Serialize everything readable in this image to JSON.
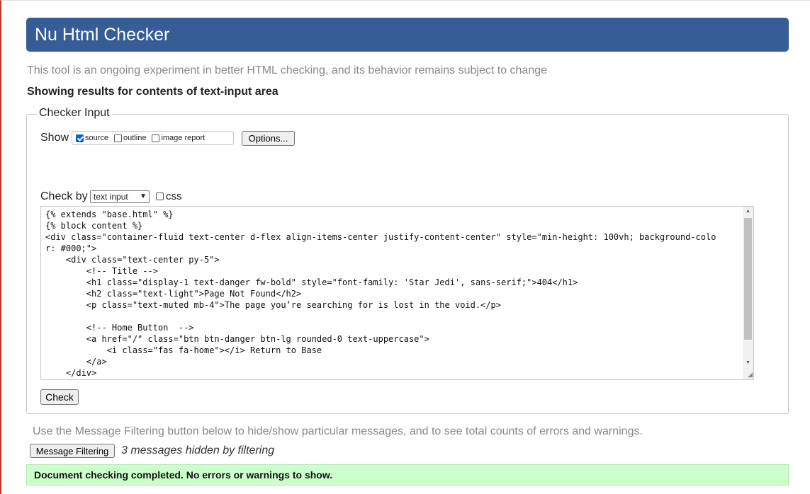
{
  "header": {
    "title": "Nu Html Checker"
  },
  "intro": "This tool is an ongoing experiment in better HTML checking, and its behavior remains subject to change",
  "results_heading": "Showing results for contents of text-input area",
  "checker_input": {
    "legend": "Checker Input",
    "show_label": "Show",
    "show_options": [
      {
        "label": "source",
        "checked": true
      },
      {
        "label": "outline",
        "checked": false
      },
      {
        "label": "image report",
        "checked": false
      }
    ],
    "options_button": "Options...",
    "check_by_label": "Check by",
    "check_by_selected": "text input",
    "css_label": "css",
    "source_code": "{% extends \"base.html\" %}\n{% block content %}\n<div class=\"container-fluid text-center d-flex align-items-center justify-content-center\" style=\"min-height: 100vh; background-color: #000;\">\n    <div class=\"text-center py-5\">\n        <!-- Title -->\n        <h1 class=\"display-1 text-danger fw-bold\" style=\"font-family: 'Star Jedi', sans-serif;\">404</h1>\n        <h2 class=\"text-light\">Page Not Found</h2>\n        <p class=\"text-muted mb-4\">The page you’re searching for is lost in the void.</p>\n\n        <!-- Home Button  -->\n        <a href=\"/\" class=\"btn btn-danger btn-lg rounded-0 text-uppercase\">\n            <i class=\"fas fa-home\"></i> Return to Base\n        </a>\n    </div>",
    "check_button": "Check"
  },
  "filtering": {
    "note": "Use the Message Filtering button below to hide/show particular messages, and to see total counts of errors and warnings.",
    "button": "Message Filtering",
    "hidden_count": "3 messages hidden by filtering"
  },
  "result": "Document checking completed. No errors or warnings to show.",
  "colors": {
    "header_bg": "#365d95",
    "success_bg": "#ccffcc",
    "checkbox_accent": "#0b62d6"
  }
}
